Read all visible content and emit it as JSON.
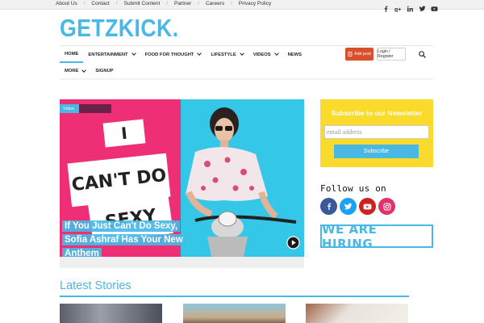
{
  "topbar": {
    "links": [
      "About Us",
      "Contact",
      "Submit Content",
      "Partner",
      "Careers",
      "Privacy Policy"
    ],
    "social_icons": [
      "facebook-icon",
      "google-plus-icon",
      "linkedin-icon",
      "twitter-icon",
      "youtube-icon"
    ]
  },
  "logo": {
    "text": "GETZKICK."
  },
  "nav": {
    "items": [
      {
        "label": "HOME",
        "active": true,
        "dropdown": false
      },
      {
        "label": "ENTERTAINMENT",
        "active": false,
        "dropdown": true
      },
      {
        "label": "FOOD FOR THOUGHT",
        "active": false,
        "dropdown": true
      },
      {
        "label": "LIFESTYLE",
        "active": false,
        "dropdown": true
      },
      {
        "label": "VIDEOS",
        "active": false,
        "dropdown": true
      },
      {
        "label": "NEWS",
        "active": false,
        "dropdown": false
      }
    ],
    "row2": [
      {
        "label": "MORE",
        "dropdown": true
      },
      {
        "label": "SIGNUP",
        "dropdown": false
      }
    ],
    "add_post": "Add post",
    "login": "Login / Register"
  },
  "featured": {
    "tag": "Video",
    "title": "If You Just Can't Do Sexy, Sofia Ashraf Has Your New Anthem",
    "poster_lines": [
      "I",
      "CAN'T DO",
      "SEXY"
    ]
  },
  "newsletter": {
    "title": "Subscribe to our Newsletter",
    "placeholder": "email address",
    "button": "Subscribe"
  },
  "follow": {
    "title": "Follow us on",
    "icons": [
      {
        "name": "facebook-icon",
        "color": "#3b5998"
      },
      {
        "name": "twitter-icon",
        "color": "#1da1f2"
      },
      {
        "name": "youtube-icon",
        "color": "#cd201f"
      },
      {
        "name": "instagram-icon",
        "color": "#e1306c"
      }
    ]
  },
  "hiring": {
    "text": "WE ARE HIRING"
  },
  "latest": {
    "title": "Latest Stories"
  },
  "colors": {
    "accent": "#49b8e5",
    "newsletter_bg": "#fadb2c",
    "add_post": "#d94f2b"
  }
}
